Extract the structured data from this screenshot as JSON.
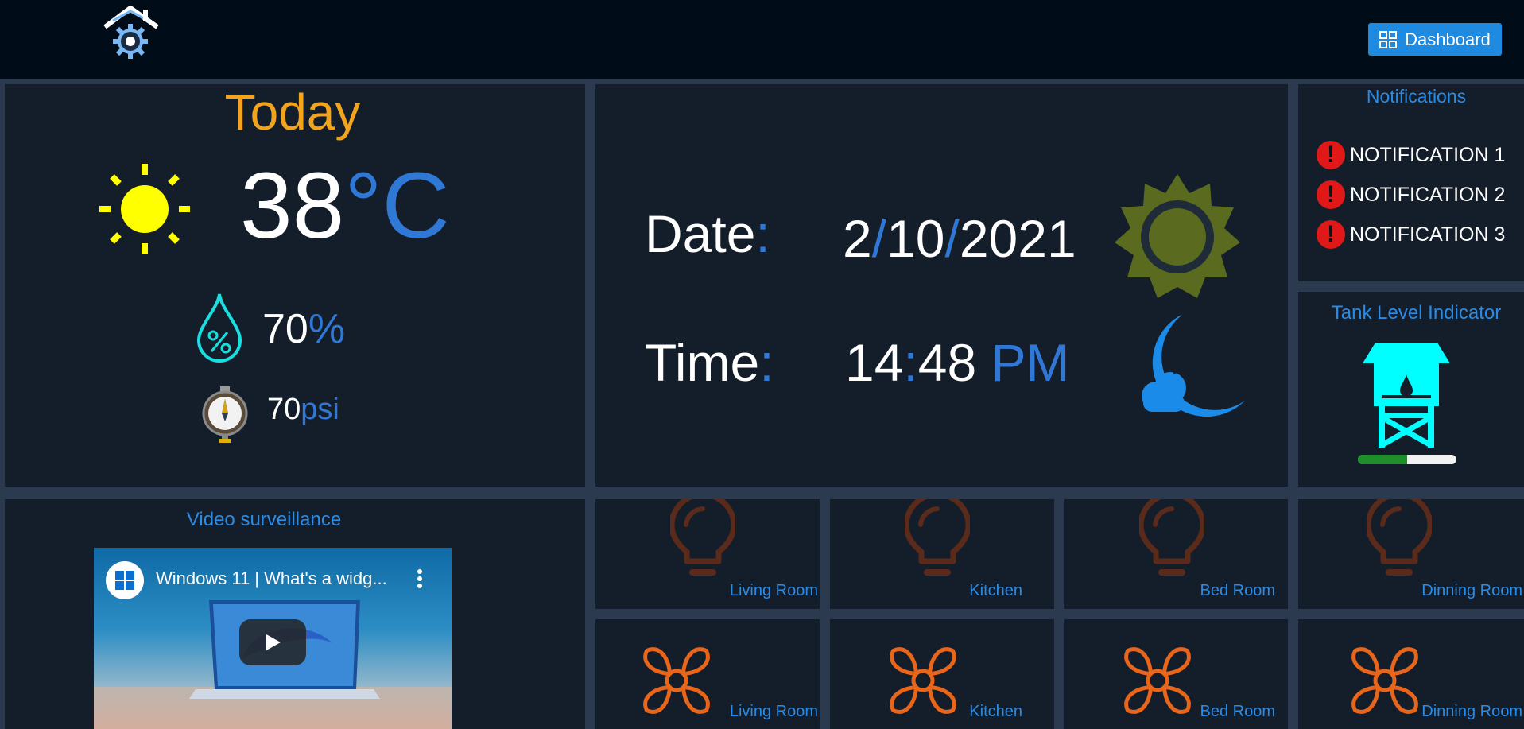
{
  "header": {
    "logo": "smart-home-logo",
    "dashboard_label": "Dashboard",
    "dashboard_icon": "grid-icon"
  },
  "weather": {
    "title": "Today",
    "temperature_value": "38",
    "temperature_unit": "°C",
    "humidity_value": "70",
    "humidity_unit": "%",
    "pressure_value": "70",
    "pressure_unit": "psi"
  },
  "datetime": {
    "date_label": "Date",
    "date_sep": ":",
    "date_day": "2",
    "date_month": "10",
    "date_year": "2021",
    "slash": "/",
    "time_label": "Time",
    "time_sep": ":",
    "time_hour": "14",
    "time_minute": "48",
    "time_period": "PM"
  },
  "notifications": {
    "title": "Notifications",
    "items": [
      "NOTIFICATION 1",
      "NOTIFICATION 2",
      "NOTIFICATION 3"
    ],
    "icon_glyph": "!"
  },
  "tank": {
    "title": "Tank Level Indicator",
    "level_fraction": 0.5
  },
  "video": {
    "title": "Video surveillance",
    "video_title": "Windows 11 | What's a widg..."
  },
  "lights": [
    {
      "label": "Living Room"
    },
    {
      "label": "Kitchen"
    },
    {
      "label": "Bed Room"
    },
    {
      "label": "Dinning Room"
    }
  ],
  "fans": [
    {
      "label": "Living Room"
    },
    {
      "label": "Kitchen"
    },
    {
      "label": "Bed Room"
    },
    {
      "label": "Dinning Room"
    }
  ],
  "colors": {
    "header_bg": "#000c17",
    "panel_bg": "#141e2a",
    "accent_blue": "#2a8be6",
    "title_orange": "#f2a51c",
    "sun_yellow": "#ffff00",
    "bulb_brown": "#5a2a1a",
    "fan_orange": "#e8651a",
    "tank_cyan": "#00ffff",
    "alert_red": "#e01818"
  }
}
